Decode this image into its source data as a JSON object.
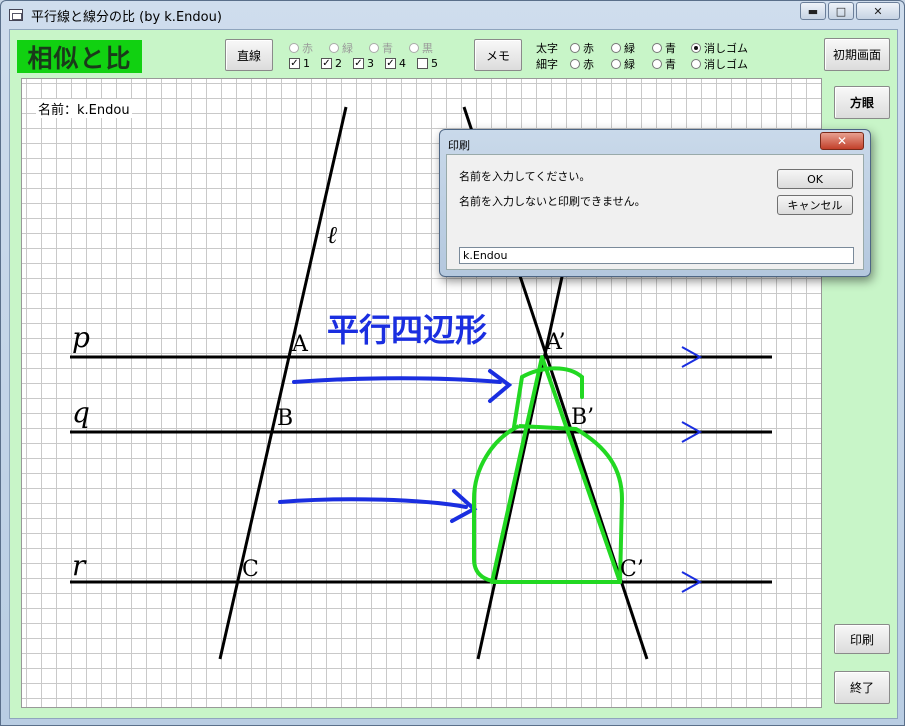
{
  "window": {
    "title": "平行線と線分の比 (by k.Endou)",
    "min": "▬",
    "max": "□",
    "close": "✕"
  },
  "logo": "相似と比",
  "toolbar": {
    "line_button": "直線",
    "memo_button": "メモ",
    "reset_button": "初期画面",
    "grid_button": "方眼",
    "print_button": "印刷",
    "exit_button": "終了"
  },
  "line_colors": [
    "赤",
    "緑",
    "青",
    "黒"
  ],
  "line_checks": [
    {
      "label": "1",
      "checked": true
    },
    {
      "label": "2",
      "checked": true
    },
    {
      "label": "3",
      "checked": true
    },
    {
      "label": "4",
      "checked": true
    },
    {
      "label": "5",
      "checked": false
    }
  ],
  "pen": {
    "thick_label": "太字",
    "thin_label": "細字",
    "colors": [
      "赤",
      "緑",
      "青"
    ],
    "eraser": "消しゴム",
    "selected": "thick-eraser"
  },
  "canvas": {
    "name_label": "名前：k.Endou",
    "line_labels": {
      "l": "ℓ",
      "p": "p",
      "q": "q",
      "r": "r"
    },
    "points": {
      "A": "A",
      "B": "B",
      "C": "C",
      "A2": "A’",
      "B2": "B’",
      "C2": "C’"
    },
    "memo_text": "平行四辺形"
  },
  "dialog": {
    "title": "印刷",
    "message1": "名前を入力してください。",
    "message2": "名前を入力しないと印刷できません。",
    "ok": "OK",
    "cancel": "キャンセル",
    "input_value": "k.Endou"
  },
  "colors": {
    "client_bg": "#c8f5c8",
    "logo_bg": "#11d111",
    "ink_blue": "#1a2ee0",
    "ink_green": "#22d822"
  }
}
